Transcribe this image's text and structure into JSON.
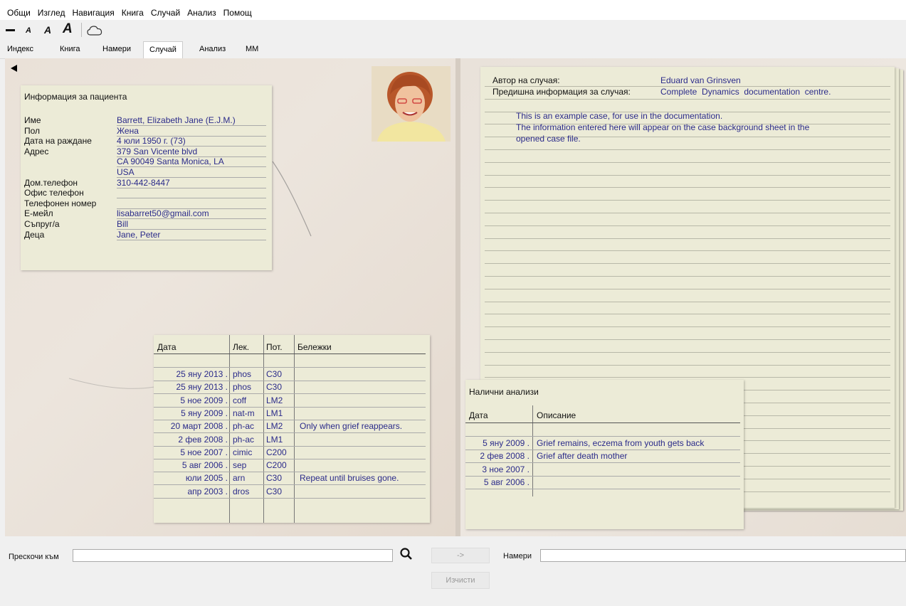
{
  "menu": [
    "Общи",
    "Изглед",
    "Навигация",
    "Книга",
    "Случай",
    "Анализ",
    "Помощ"
  ],
  "tabs": [
    "Индекс",
    "Книга",
    "Намери",
    "Случай",
    "Анализ",
    "ММ"
  ],
  "patient": {
    "title": "Информация за пациента",
    "fields": [
      {
        "label": "Име",
        "value": "Barrett, Elizabeth Jane (E.J.M.)"
      },
      {
        "label": "Пол",
        "value": "Жена"
      },
      {
        "label": "Дата на раждане",
        "value": "4 юли 1950 г. (73)"
      },
      {
        "label": "Адрес",
        "value": "379 San Vicente blvd"
      },
      {
        "label": "",
        "value": "CA 90049  Santa Monica, LA"
      },
      {
        "label": "",
        "value": "USA"
      },
      {
        "label": "Дом.телефон",
        "value": "310-442-8447"
      },
      {
        "label": "Офис телефон",
        "value": ""
      },
      {
        "label": "Телефонен номер",
        "value": ""
      },
      {
        "label": "E-мейл",
        "value": "lisabarret50@gmail.com"
      },
      {
        "label": "Съпруг/а",
        "value": "Bill"
      },
      {
        "label": "Деца",
        "value": "Jane, Peter"
      }
    ]
  },
  "prescriptions": {
    "headers": [
      "Дата",
      "Лек.",
      "Пот.",
      "Бележки"
    ],
    "rows": [
      [
        "25 яну 2013 .",
        "phos",
        "C30",
        ""
      ],
      [
        "25 яну 2013 .",
        "phos",
        "C30",
        ""
      ],
      [
        "5 ное 2009 .",
        "coff",
        "LM2",
        ""
      ],
      [
        "5 яну 2009 .",
        "nat-m",
        "LM1",
        ""
      ],
      [
        "20 март 2008 .",
        "ph-ac",
        "LM2",
        "Only when grief reappears."
      ],
      [
        "2 фев 2008 .",
        "ph-ac",
        "LM1",
        ""
      ],
      [
        "5 ное 2007 .",
        "cimic",
        "C200",
        ""
      ],
      [
        "5 авг 2006 .",
        "sep",
        "C200",
        ""
      ],
      [
        "юли 2005 .",
        "arn",
        "C30",
        "Repeat until bruises gone."
      ],
      [
        "апр 2003 .",
        "dros",
        "C30",
        ""
      ]
    ]
  },
  "case_info": {
    "author_label": "Автор на случая:",
    "author": "Eduard van Grinsven",
    "prev_label": "Предишна информация за случая:",
    "prev_value": "Complete  Dynamics  documentation  centre.",
    "text": [
      "This is an example case, for use in the documentation.",
      "The information entered here will appear on the case background sheet in the",
      "opened case file."
    ]
  },
  "analyses": {
    "title": "Налични анализи",
    "headers": [
      "Дата",
      "Описание"
    ],
    "rows": [
      [
        "5 яну 2009 .",
        "Grief remains, eczema from youth gets back"
      ],
      [
        "2 фев 2008 .",
        "Grief after death mother"
      ],
      [
        "3 ное 2007 .",
        ""
      ],
      [
        "5 авг 2006 .",
        ""
      ]
    ]
  },
  "bottom": {
    "jump_label": "Прескочи към",
    "arrow_label": "->",
    "find_label": "Намери",
    "clear_label": "Изчисти"
  },
  "icons": {
    "back": "back-arrow-icon",
    "search": "search-icon",
    "cloud": "cloud-icon"
  },
  "colors": {
    "value_text": "#2b2b8a",
    "note_bg": "#ecebd7"
  }
}
